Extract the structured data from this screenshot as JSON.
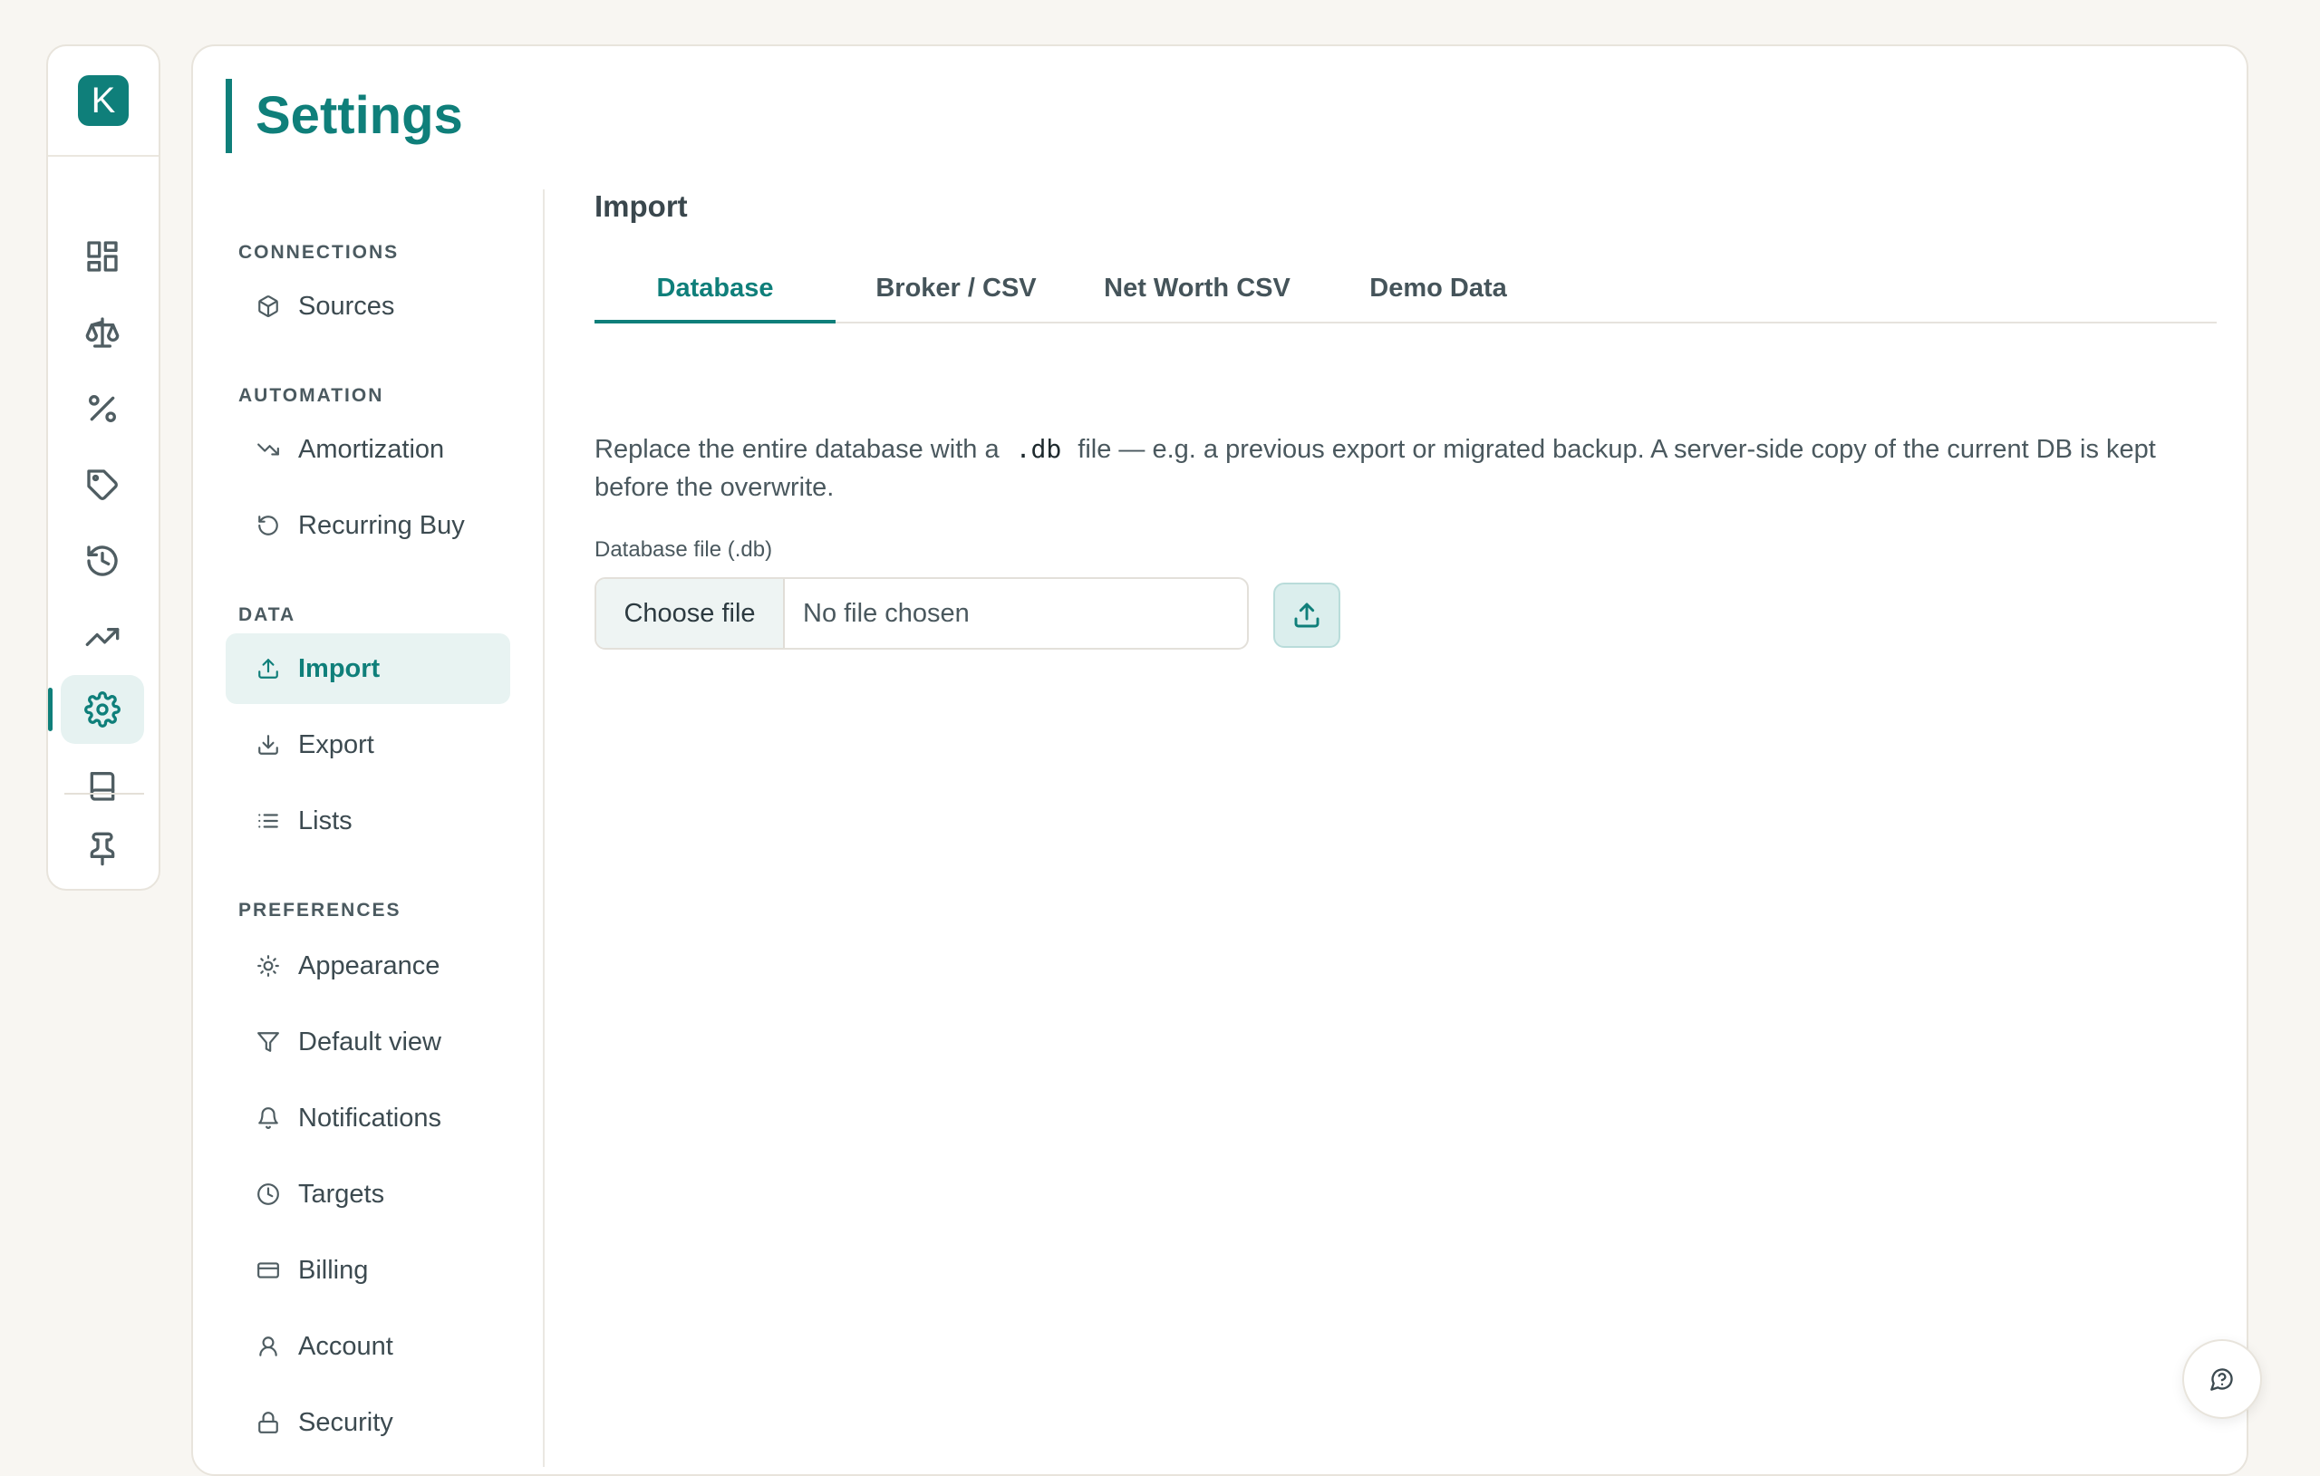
{
  "app": {
    "logo_letter": "K"
  },
  "rail": {
    "items": [
      {
        "name": "dashboard-icon"
      },
      {
        "name": "balance-scale-icon"
      },
      {
        "name": "percent-icon"
      },
      {
        "name": "tag-icon"
      },
      {
        "name": "history-icon"
      },
      {
        "name": "trending-up-icon"
      },
      {
        "name": "gear-icon",
        "active": true
      },
      {
        "name": "book-icon"
      },
      {
        "name": "pin-icon"
      }
    ]
  },
  "page": {
    "title": "Settings"
  },
  "nav": {
    "sections": [
      {
        "label": "CONNECTIONS",
        "items": [
          {
            "label": "Sources",
            "icon": "box-icon"
          }
        ]
      },
      {
        "label": "AUTOMATION",
        "items": [
          {
            "label": "Amortization",
            "icon": "trending-down-icon"
          },
          {
            "label": "Recurring Buy",
            "icon": "rotate-icon"
          }
        ]
      },
      {
        "label": "DATA",
        "items": [
          {
            "label": "Import",
            "icon": "upload-icon",
            "active": true
          },
          {
            "label": "Export",
            "icon": "download-icon"
          },
          {
            "label": "Lists",
            "icon": "list-icon"
          }
        ]
      },
      {
        "label": "PREFERENCES",
        "items": [
          {
            "label": "Appearance",
            "icon": "sun-icon"
          },
          {
            "label": "Default view",
            "icon": "filter-icon"
          },
          {
            "label": "Notifications",
            "icon": "bell-icon"
          },
          {
            "label": "Targets",
            "icon": "clock-icon"
          },
          {
            "label": "Billing",
            "icon": "credit-card-icon"
          },
          {
            "label": "Account",
            "icon": "user-icon"
          },
          {
            "label": "Security",
            "icon": "lock-icon"
          }
        ]
      }
    ]
  },
  "content": {
    "section_title": "Import",
    "tabs": [
      "Database",
      "Broker / CSV",
      "Net Worth CSV",
      "Demo Data"
    ],
    "active_tab": "Database",
    "description_before": "Replace the entire database with a",
    "description_code": ".db",
    "description_after": "file — e.g. a previous export or migrated backup. A server-side copy of the current DB is kept before the overwrite.",
    "field_label": "Database file (.db)",
    "file_button": "Choose file",
    "file_status": "No file chosen"
  },
  "colors": {
    "accent": "#0f7f7a",
    "background": "#f8f6f2"
  }
}
